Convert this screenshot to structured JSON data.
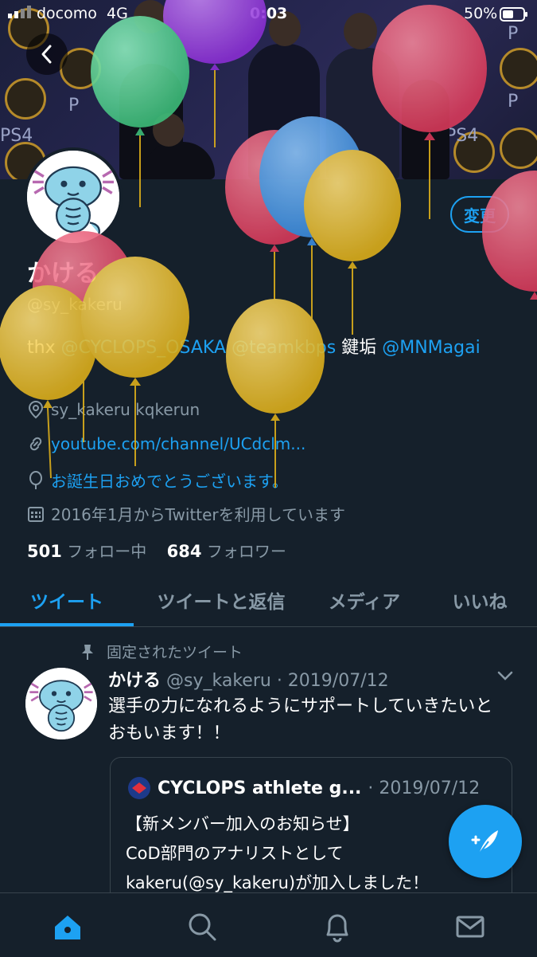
{
  "status_bar": {
    "carrier": "docomo",
    "network": "4G",
    "time": "0:03",
    "battery": "50%"
  },
  "profile": {
    "name": "かける",
    "handle": "@sy_kakeru",
    "edit_button": "変更",
    "bio_prefix": "thx ",
    "bio_mention1": "@CYCLOPS_OSAKA",
    "bio_mention2": "@teamkbps",
    "bio_text": " 鍵垢 ",
    "bio_mention3": "@MNMagai",
    "location": "sy_kakeru kqkerun",
    "website": "youtube.com/channel/UCdclm...",
    "birthday": "お誕生日おめでとうございます。",
    "joined": "2016年1月からTwitterを利用しています",
    "following_count": "501",
    "following_label": "フォロー中",
    "followers_count": "684",
    "followers_label": "フォロワー"
  },
  "tabs": [
    "ツイート",
    "ツイートと返信",
    "メディア",
    "いいね"
  ],
  "pinned_tweet": {
    "pinned_label": "固定されたツイート",
    "author_name": "かける",
    "author_handle": "@sy_kakeru",
    "date": "· 2019/07/12",
    "text": "選手の力になれるようにサポートしていきたいとおもいます！！",
    "quote": {
      "author_name": "CYCLOPS athlete g...",
      "date": "· 2019/07/12",
      "line1": "【新メンバー加入のお知らせ】",
      "line2": "CoD部門のアナリストとして",
      "line3": "kakeru(@sy_kakeru)が加入しました！"
    }
  },
  "colors": {
    "background": "#15202b",
    "accent": "#1da1f2",
    "muted": "#8899a6"
  },
  "icons": {
    "back": "chevron-left-icon",
    "location": "location-pin-icon",
    "link": "link-icon",
    "birthday": "balloon-icon",
    "joined": "calendar-icon",
    "pin": "pin-icon",
    "caret": "chevron-down-icon",
    "compose": "compose-feather-icon",
    "nav": [
      "home-icon",
      "search-icon",
      "bell-icon",
      "mail-icon"
    ]
  }
}
